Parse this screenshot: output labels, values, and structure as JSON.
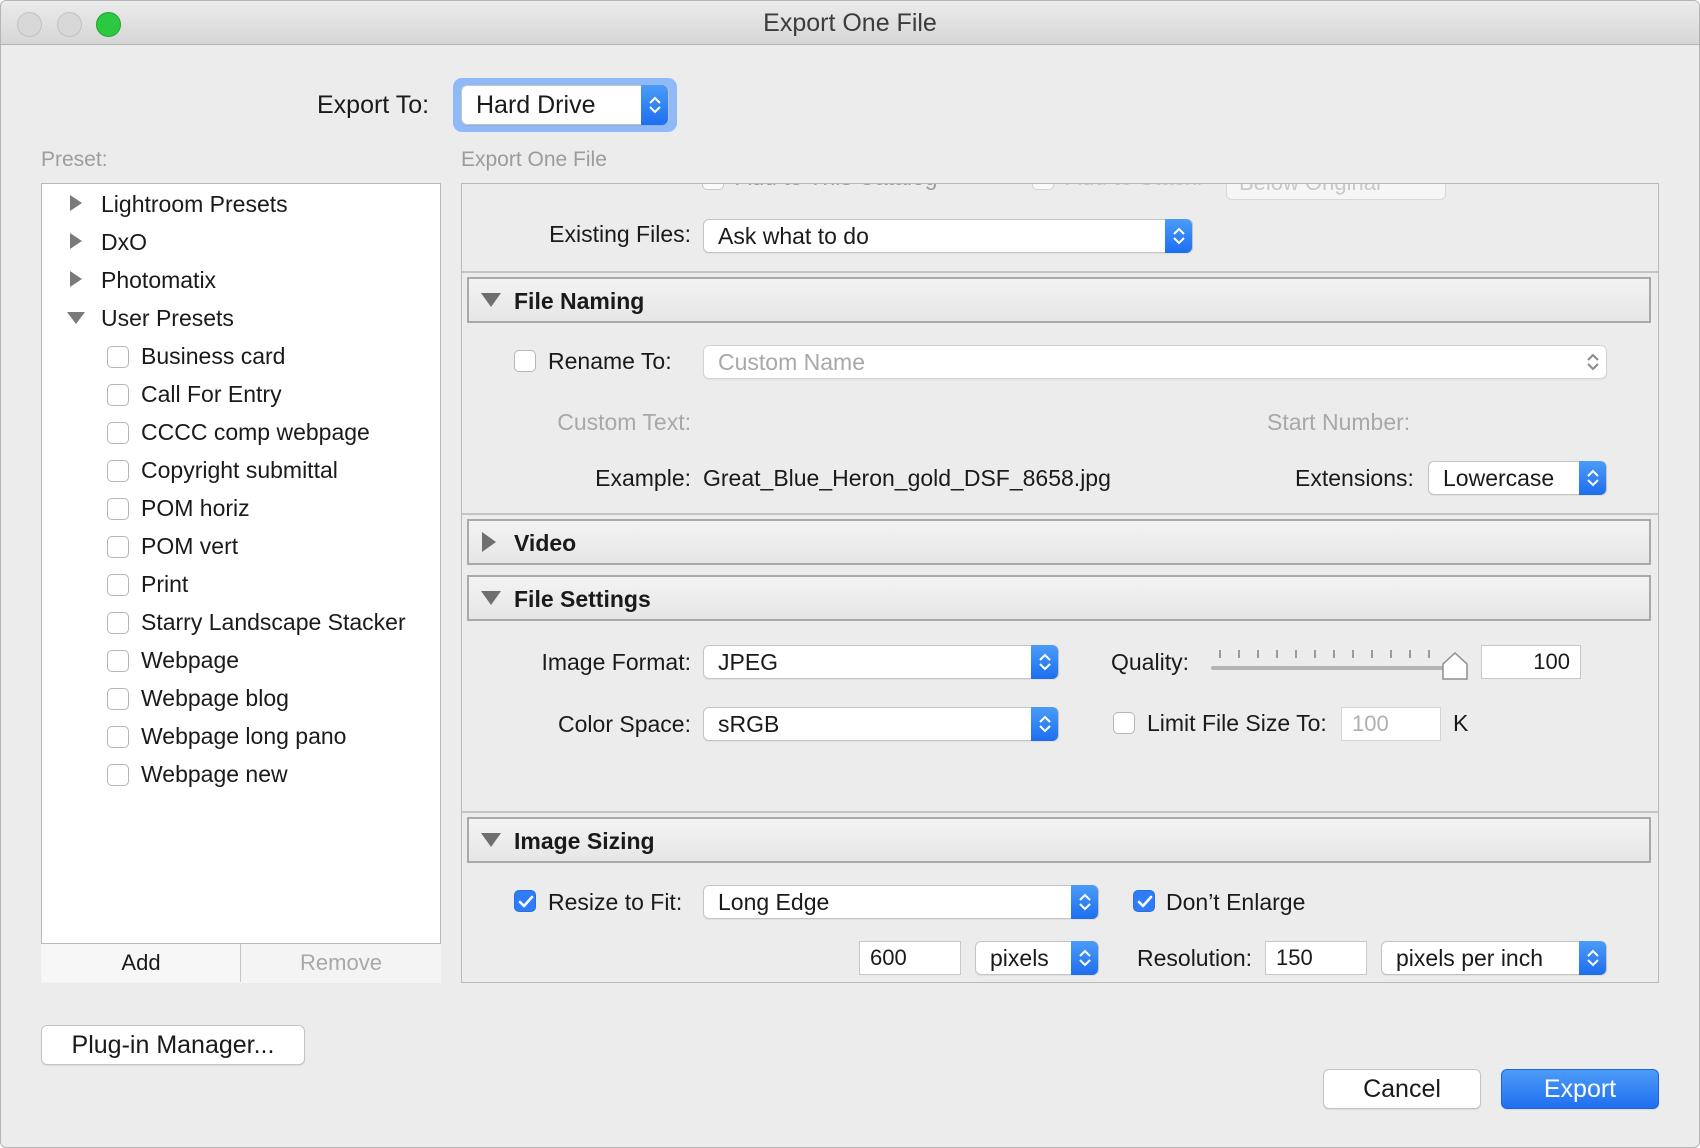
{
  "window": {
    "title": "Export One File"
  },
  "export_to": {
    "label": "Export To:",
    "value": "Hard Drive"
  },
  "preset": {
    "label": "Preset:",
    "groups": [
      {
        "label": "Lightroom Presets",
        "expanded": false
      },
      {
        "label": "DxO",
        "expanded": false
      },
      {
        "label": "Photomatix",
        "expanded": false
      },
      {
        "label": "User Presets",
        "expanded": true
      }
    ],
    "items": [
      "Business card",
      "Call For Entry",
      "CCCC comp webpage",
      "Copyright submittal",
      "POM horiz",
      "POM vert",
      "Print",
      "Starry Landscape Stacker",
      "Webpage",
      "Webpage blog",
      "Webpage long pano",
      "Webpage new"
    ],
    "add_label": "Add",
    "remove_label": "Remove"
  },
  "panel": {
    "header": "Export One File",
    "partial_row": {
      "add_to_catalog": "Add to This Catalog",
      "add_to_stack": "Add to Stack:",
      "stack_value": "Below Original"
    },
    "existing_files": {
      "label": "Existing Files:",
      "value": "Ask what to do"
    }
  },
  "file_naming": {
    "title": "File Naming",
    "rename_label": "Rename To:",
    "rename_checked": false,
    "rename_value": "Custom Name",
    "custom_text_label": "Custom Text:",
    "start_number_label": "Start Number:",
    "example_label": "Example:",
    "example_value": "Great_Blue_Heron_gold_DSF_8658.jpg",
    "extensions_label": "Extensions:",
    "extensions_value": "Lowercase"
  },
  "video": {
    "title": "Video"
  },
  "file_settings": {
    "title": "File Settings",
    "image_format_label": "Image Format:",
    "image_format_value": "JPEG",
    "quality_label": "Quality:",
    "quality_value": "100",
    "quality_fraction": 1.0,
    "color_space_label": "Color Space:",
    "color_space_value": "sRGB",
    "limit_label": "Limit File Size To:",
    "limit_checked": false,
    "limit_value": "100",
    "limit_unit": "K"
  },
  "image_sizing": {
    "title": "Image Sizing",
    "resize_label": "Resize to Fit:",
    "resize_checked": true,
    "resize_value": "Long Edge",
    "dont_enlarge_label": "Don’t Enlarge",
    "dont_enlarge_checked": true,
    "size_value": "600",
    "size_unit": "pixels",
    "resolution_label": "Resolution:",
    "resolution_value": "150",
    "resolution_unit": "pixels per inch"
  },
  "footer": {
    "plugin_manager_label": "Plug-in Manager...",
    "cancel_label": "Cancel",
    "export_label": "Export"
  },
  "colors": {
    "accent": "#2f7cf6",
    "window_bg": "#ececec"
  }
}
